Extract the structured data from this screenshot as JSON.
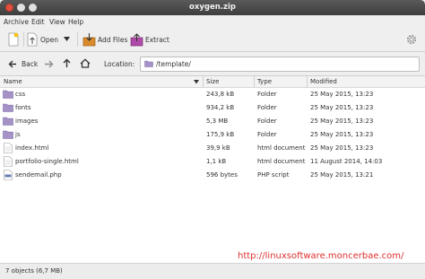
{
  "window": {
    "title": "oxygen.zip"
  },
  "menubar": {
    "items": [
      "Archive",
      "Edit",
      "View",
      "Help"
    ]
  },
  "toolbar": {
    "open_label": "Open",
    "add_files_label": "Add Files",
    "extract_label": "Extract"
  },
  "location": {
    "back_label": "Back",
    "label": "Location:",
    "path": "/template/"
  },
  "columns": [
    "Name",
    "Size",
    "Type",
    "Modified"
  ],
  "files": [
    {
      "name": "css",
      "size": "243,8 kB",
      "type": "Folder",
      "modified": "25 May 2015, 13:23",
      "kind": "folder"
    },
    {
      "name": "fonts",
      "size": "934,2 kB",
      "type": "Folder",
      "modified": "25 May 2015, 13:23",
      "kind": "folder"
    },
    {
      "name": "images",
      "size": "5,3 MB",
      "type": "Folder",
      "modified": "25 May 2015, 13:23",
      "kind": "folder"
    },
    {
      "name": "js",
      "size": "175,9 kB",
      "type": "Folder",
      "modified": "25 May 2015, 13:23",
      "kind": "folder"
    },
    {
      "name": "index.html",
      "size": "39,9 kB",
      "type": "html document",
      "modified": "25 May 2015, 13:23",
      "kind": "html"
    },
    {
      "name": "portfolio-single.html",
      "size": "1,1 kB",
      "type": "html document",
      "modified": "11 August 2014, 14:03",
      "kind": "html"
    },
    {
      "name": "sendemail.php",
      "size": "596 bytes",
      "type": "PHP script",
      "modified": "25 May 2015, 13:21",
      "kind": "php"
    }
  ],
  "status": {
    "text": "7 objects (6,7 MB)"
  },
  "watermark": {
    "text": "http://linuxsoftware.moncerbae.com/"
  },
  "colors": {
    "folder": "#a593c8",
    "accent": "#e03030",
    "titlebar": "#4a4a4a"
  }
}
